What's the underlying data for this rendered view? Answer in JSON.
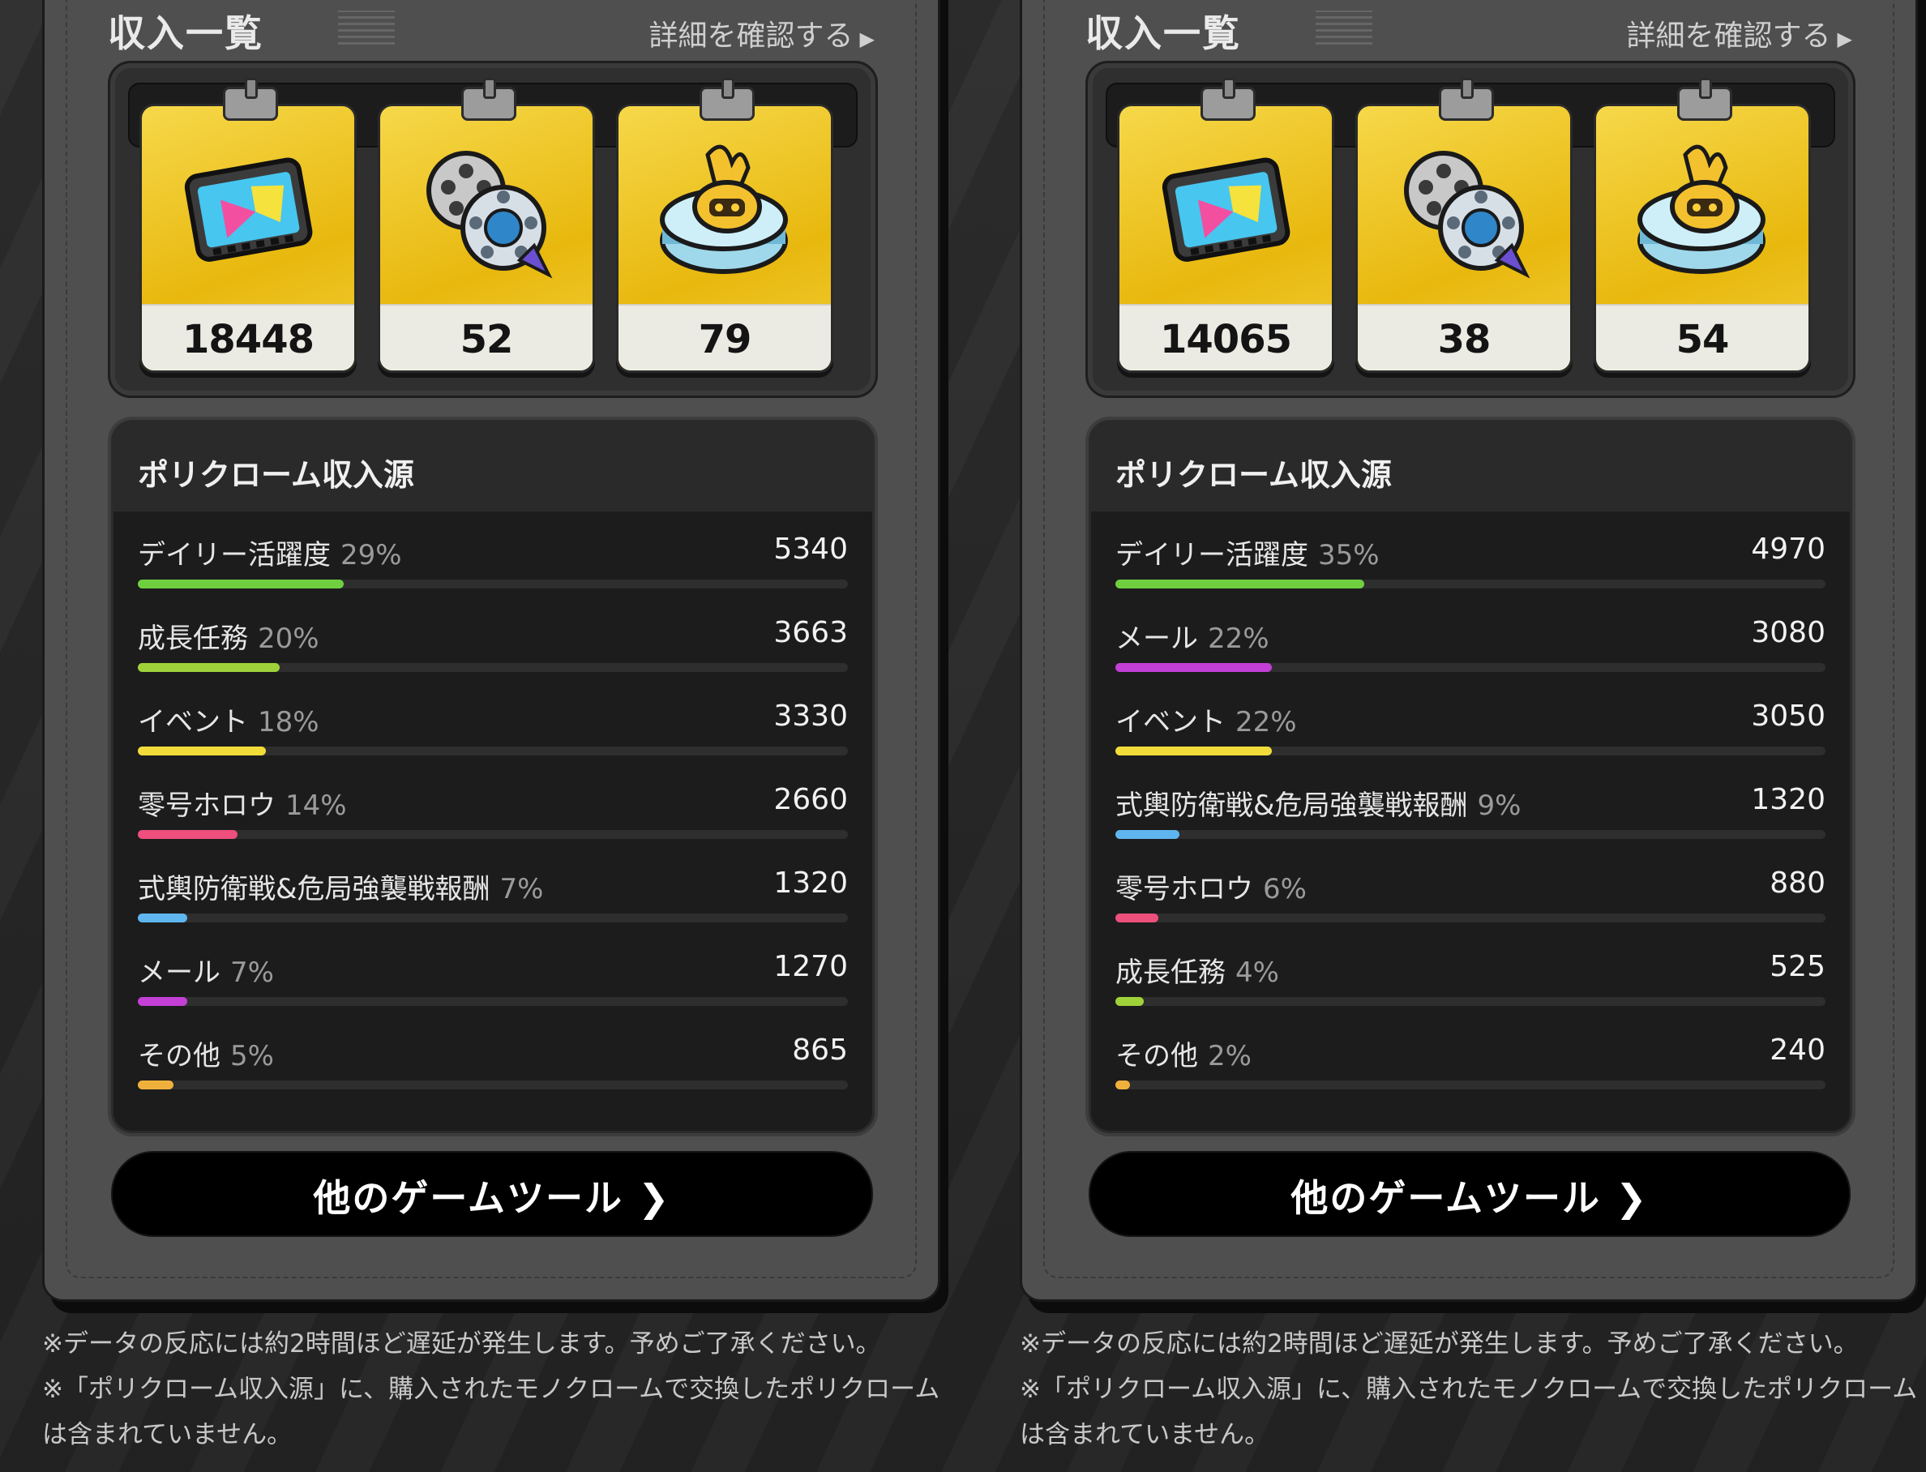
{
  "panels": [
    {
      "section_title": "収入一覧",
      "detail_link": "詳細を確認する",
      "items": [
        {
          "icon": "film-reel-ticket-icon",
          "value": "18448"
        },
        {
          "icon": "film-reels-icon",
          "value": "52"
        },
        {
          "icon": "bangboo-badge-icon",
          "value": "79"
        }
      ],
      "sources_title": "ポリクローム収入源",
      "sources": [
        {
          "label": "デイリー活躍度",
          "pct": "29%",
          "value": "5340",
          "fraction": 0.29,
          "color": "#6fcf3f"
        },
        {
          "label": "成長任務",
          "pct": "20%",
          "value": "3663",
          "fraction": 0.2,
          "color": "#9fd23a"
        },
        {
          "label": "イベント",
          "pct": "18%",
          "value": "3330",
          "fraction": 0.18,
          "color": "#f2dc3a"
        },
        {
          "label": "零号ホロウ",
          "pct": "14%",
          "value": "2660",
          "fraction": 0.14,
          "color": "#ee4f7c"
        },
        {
          "label": "式輿防衛戦&危局強襲戦報酬",
          "pct": "7%",
          "value": "1320",
          "fraction": 0.07,
          "color": "#5fb5ee"
        },
        {
          "label": "メール",
          "pct": "7%",
          "value": "1270",
          "fraction": 0.07,
          "color": "#c33fd6"
        },
        {
          "label": "その他",
          "pct": "5%",
          "value": "865",
          "fraction": 0.05,
          "color": "#f0b13c"
        }
      ],
      "button_label": "他のゲームツール ❯",
      "notes": [
        "※データの反応には約2時間ほど遅延が発生します。予めご了承ください。",
        "※「ポリクローム収入源」に、購入されたモノクロームで交換したポリクロームは含まれていません。"
      ]
    },
    {
      "section_title": "収入一覧",
      "detail_link": "詳細を確認する",
      "items": [
        {
          "icon": "film-reel-ticket-icon",
          "value": "14065"
        },
        {
          "icon": "film-reels-icon",
          "value": "38"
        },
        {
          "icon": "bangboo-badge-icon",
          "value": "54"
        }
      ],
      "sources_title": "ポリクローム収入源",
      "sources": [
        {
          "label": "デイリー活躍度",
          "pct": "35%",
          "value": "4970",
          "fraction": 0.35,
          "color": "#6fcf3f"
        },
        {
          "label": "メール",
          "pct": "22%",
          "value": "3080",
          "fraction": 0.22,
          "color": "#c33fd6"
        },
        {
          "label": "イベント",
          "pct": "22%",
          "value": "3050",
          "fraction": 0.22,
          "color": "#f2dc3a"
        },
        {
          "label": "式輿防衛戦&危局強襲戦報酬",
          "pct": "9%",
          "value": "1320",
          "fraction": 0.09,
          "color": "#5fb5ee"
        },
        {
          "label": "零号ホロウ",
          "pct": "6%",
          "value": "880",
          "fraction": 0.06,
          "color": "#ee4f7c"
        },
        {
          "label": "成長任務",
          "pct": "4%",
          "value": "525",
          "fraction": 0.04,
          "color": "#9fd23a"
        },
        {
          "label": "その他",
          "pct": "2%",
          "value": "240",
          "fraction": 0.02,
          "color": "#f0b13c"
        }
      ],
      "button_label": "他のゲームツール ❯",
      "notes": [
        "※データの反応には約2時間ほど遅延が発生します。予めご了承ください。",
        "※「ポリクローム収入源」に、購入されたモノクロームで交換したポリクロームは含まれていません。"
      ]
    }
  ]
}
